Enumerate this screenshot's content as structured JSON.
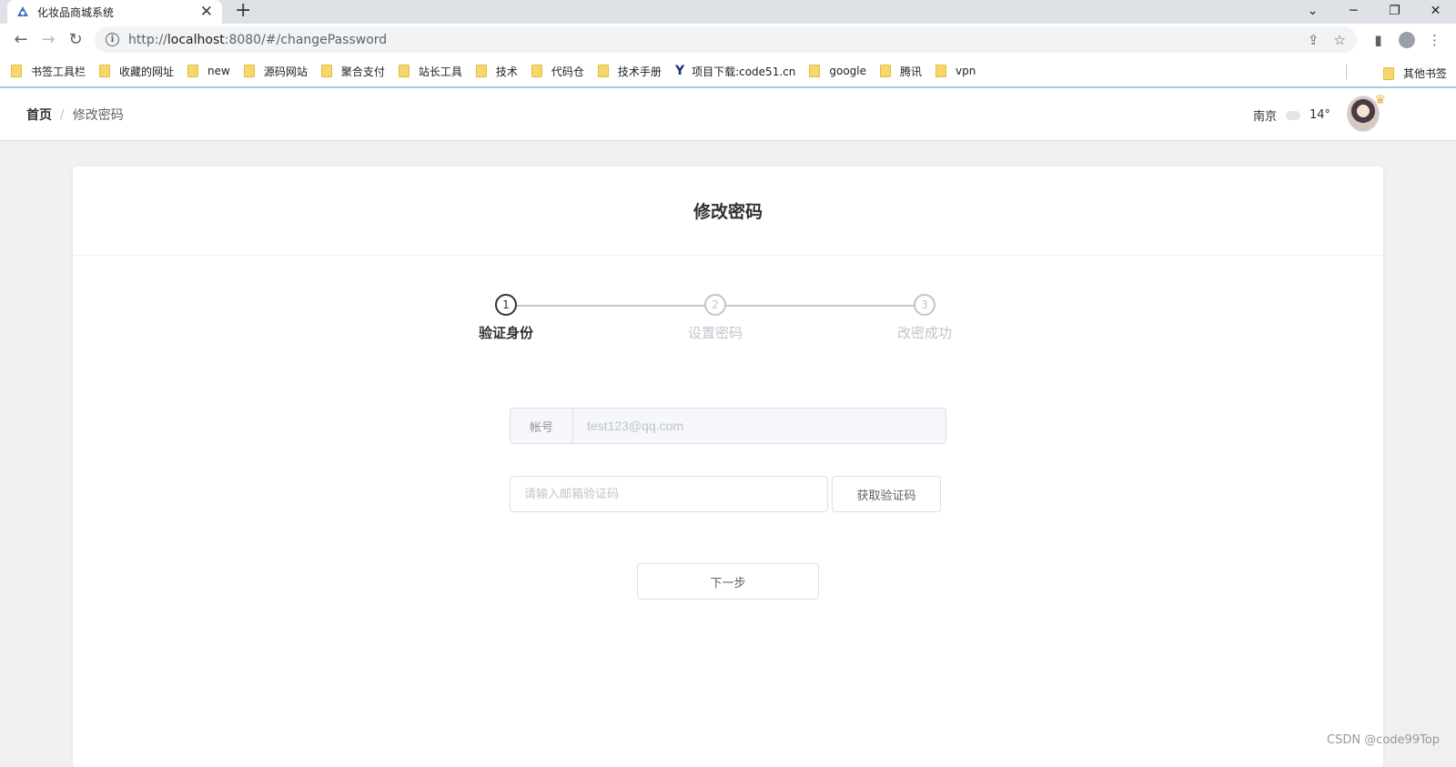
{
  "browser": {
    "tab_title": "化妆品商城系统",
    "new_tab_glyph": "+",
    "url_prefix": "http://",
    "url_host": "localhost",
    "url_rest": ":8080/#/changePassword",
    "bookmarks": [
      "书签工具栏",
      "收藏的网址",
      "new",
      "源码网站",
      "聚合支付",
      "站长工具",
      "技术",
      "代码仓",
      "技术手册",
      "项目下载:code51.cn",
      "google",
      "腾讯",
      "vpn"
    ],
    "other_bookmarks": "其他书签"
  },
  "header": {
    "breadcrumb_home": "首页",
    "breadcrumb_sep": "/",
    "breadcrumb_current": "修改密码",
    "city": "南京",
    "temperature": "14°"
  },
  "page": {
    "title": "修改密码",
    "steps": [
      {
        "num": "1",
        "label": "验证身份"
      },
      {
        "num": "2",
        "label": "设置密码"
      },
      {
        "num": "3",
        "label": "改密成功"
      }
    ],
    "account_label": "帐号",
    "account_value": "test123@qq.com",
    "code_placeholder": "请输入邮箱验证码",
    "get_code_button": "获取验证码",
    "next_button": "下一步"
  },
  "watermark": "CSDN @code99Top"
}
